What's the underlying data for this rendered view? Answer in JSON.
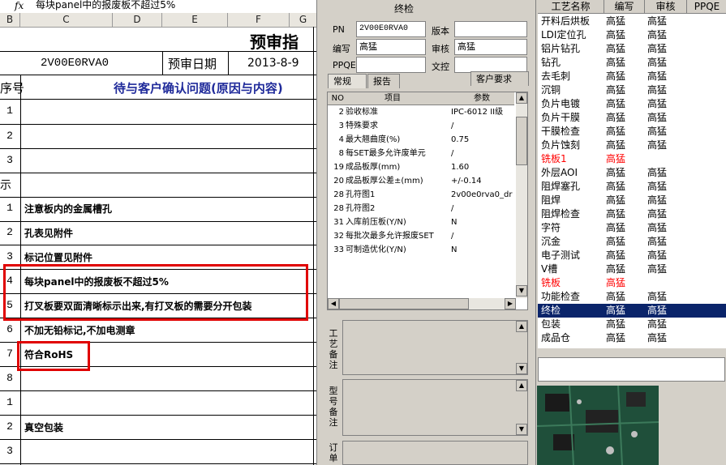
{
  "formula_bar": {
    "fx": "fx",
    "text": "每块panel中的报废板不超过5%"
  },
  "columns": [
    "B",
    "C",
    "D",
    "E",
    "F",
    "G"
  ],
  "sheet": {
    "title": "预审指",
    "pn": "2V00E0RVA0",
    "date_label": "预审日期",
    "date_value": "2013-8-9",
    "row_header_no": "序号",
    "row_header_issue": "待与客户确认问题(原因与内容)",
    "row_a": "1",
    "row_b": "2",
    "row_c": "3",
    "row_d": "示",
    "row_e": "1",
    "row_e_text": "注意板内的金属槽孔",
    "row_f": "2",
    "row_f_text": "孔表见附件",
    "row_g": "3",
    "row_g_text": "标记位置见附件",
    "row_h": "4",
    "row_h_text": "每块panel中的报废板不超过5%",
    "row_i": "5",
    "row_i_text": "打叉板要双面清晰标示出来,有打叉板的需要分开包装",
    "row_j": "6",
    "row_j_text": "不加无铅标记,不加电测章",
    "row_k": "7",
    "row_k_text": "符合RoHS",
    "row_l": "8",
    "row_m": "1",
    "row_n": "2",
    "row_n_text": "真空包装",
    "row_o": "3"
  },
  "middle": {
    "title": "终检",
    "pn_label": "PN",
    "pn_value": "2V00E0RVA0",
    "version_label": "版本",
    "version_value": "",
    "author_label": "编写",
    "author_value": "高猛",
    "review_label": "审核",
    "review_value": "高猛",
    "ppqe_label": "PPQE",
    "ppqe_value": "",
    "doc_label": "文控",
    "doc_value": "",
    "tabs": [
      "常规",
      "报告",
      "客户要求"
    ],
    "grid_header": {
      "no": "NO",
      "item": "项目",
      "param": "参数"
    },
    "grid_rows": [
      {
        "no": "2",
        "item": "验收标准",
        "val": "IPC-6012 II级"
      },
      {
        "no": "3",
        "item": "特殊要求",
        "val": "/"
      },
      {
        "no": "4",
        "item": "最大翘曲度(%)",
        "val": "0.75"
      },
      {
        "no": "8",
        "item": "每SET最多允许废单元",
        "val": "/"
      },
      {
        "no": "19",
        "item": "成品板厚(mm)",
        "val": "1.60"
      },
      {
        "no": "20",
        "item": "成品板厚公差±(mm)",
        "val": "+/-0.14"
      },
      {
        "no": "28",
        "item": "孔符图1",
        "val": "2v00e0rva0_dr"
      },
      {
        "no": "28",
        "item": "孔符图2",
        "val": "/"
      },
      {
        "no": "31",
        "item": "入库前压板(Y/N)",
        "val": "N"
      },
      {
        "no": "32",
        "item": "每批次最多允许报废SET",
        "val": "/"
      },
      {
        "no": "33",
        "item": "可制造优化(Y/N)",
        "val": "N"
      }
    ],
    "memo1_label": "工艺备注",
    "memo2_label": "型号备注",
    "memo3_label": "订单"
  },
  "process_list": {
    "headers": [
      "工艺名称",
      "编写",
      "审核",
      "PPQE"
    ],
    "rows": [
      {
        "name": "开料后烘板",
        "a": "高猛",
        "b": "高猛",
        "style": ""
      },
      {
        "name": "LDI定位孔",
        "a": "高猛",
        "b": "高猛",
        "style": ""
      },
      {
        "name": "铝片钻孔",
        "a": "高猛",
        "b": "高猛",
        "style": ""
      },
      {
        "name": "钻孔",
        "a": "高猛",
        "b": "高猛",
        "style": ""
      },
      {
        "name": "去毛刺",
        "a": "高猛",
        "b": "高猛",
        "style": ""
      },
      {
        "name": "沉铜",
        "a": "高猛",
        "b": "高猛",
        "style": ""
      },
      {
        "name": "负片电镀",
        "a": "高猛",
        "b": "高猛",
        "style": ""
      },
      {
        "name": "负片干膜",
        "a": "高猛",
        "b": "高猛",
        "style": ""
      },
      {
        "name": "干膜检查",
        "a": "高猛",
        "b": "高猛",
        "style": ""
      },
      {
        "name": "负片蚀刻",
        "a": "高猛",
        "b": "高猛",
        "style": ""
      },
      {
        "name": "铣板1",
        "a": "高猛",
        "b": "",
        "style": "red"
      },
      {
        "name": "外层AOI",
        "a": "高猛",
        "b": "高猛",
        "style": ""
      },
      {
        "name": "阻焊塞孔",
        "a": "高猛",
        "b": "高猛",
        "style": ""
      },
      {
        "name": "阻焊",
        "a": "高猛",
        "b": "高猛",
        "style": ""
      },
      {
        "name": "阻焊检查",
        "a": "高猛",
        "b": "高猛",
        "style": ""
      },
      {
        "name": "字符",
        "a": "高猛",
        "b": "高猛",
        "style": ""
      },
      {
        "name": "沉金",
        "a": "高猛",
        "b": "高猛",
        "style": ""
      },
      {
        "name": "电子测试",
        "a": "高猛",
        "b": "高猛",
        "style": ""
      },
      {
        "name": "V槽",
        "a": "高猛",
        "b": "高猛",
        "style": ""
      },
      {
        "name": "铣板",
        "a": "高猛",
        "b": "",
        "style": "red"
      },
      {
        "name": "功能检查",
        "a": "高猛",
        "b": "高猛",
        "style": ""
      },
      {
        "name": "终检",
        "a": "高猛",
        "b": "高猛",
        "style": "sel"
      },
      {
        "name": "包装",
        "a": "高猛",
        "b": "高猛",
        "style": ""
      },
      {
        "name": "成品仓",
        "a": "高猛",
        "b": "高猛",
        "style": ""
      }
    ]
  }
}
